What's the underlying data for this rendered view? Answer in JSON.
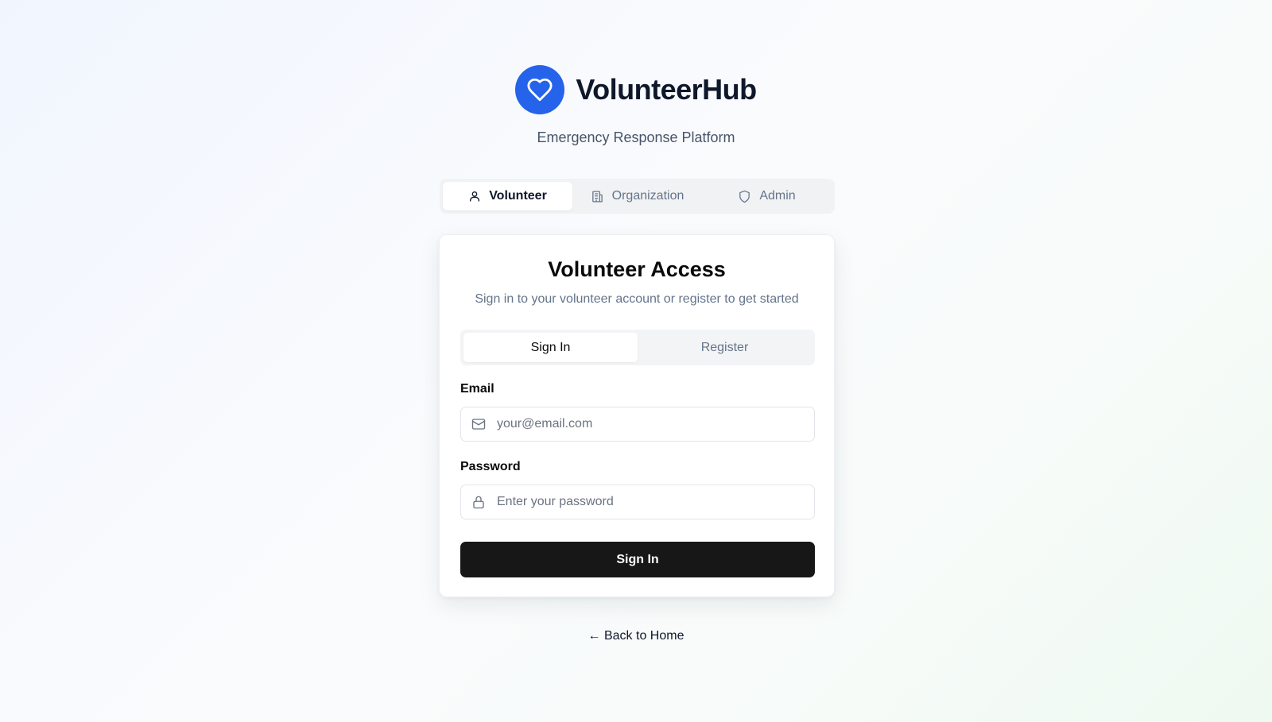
{
  "brand": {
    "name": "VolunteerHub",
    "tagline": "Emergency Response Platform",
    "logo_icon": "heart-icon",
    "accent_color": "#2563eb"
  },
  "role_tabs": [
    {
      "label": "Volunteer",
      "icon": "user-icon",
      "active": true
    },
    {
      "label": "Organization",
      "icon": "building-icon",
      "active": false
    },
    {
      "label": "Admin",
      "icon": "shield-icon",
      "active": false
    }
  ],
  "card": {
    "title": "Volunteer Access",
    "subtitle": "Sign in to your volunteer account or register to get started",
    "auth_tabs": [
      {
        "label": "Sign In",
        "active": true
      },
      {
        "label": "Register",
        "active": false
      }
    ],
    "email": {
      "label": "Email",
      "placeholder": "your@email.com",
      "value": "",
      "icon": "mail-icon"
    },
    "password": {
      "label": "Password",
      "placeholder": "Enter your password",
      "value": "",
      "icon": "lock-icon"
    },
    "submit_label": "Sign In",
    "button_color": "#171717"
  },
  "back_link": "← Back to Home"
}
